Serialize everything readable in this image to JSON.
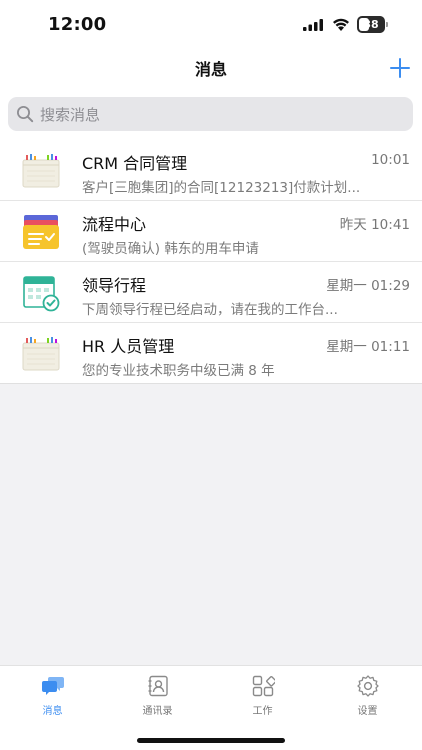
{
  "status_bar": {
    "time": "12:00",
    "battery_level": "38"
  },
  "nav": {
    "title": "消息",
    "add_icon": "plus-icon"
  },
  "search": {
    "placeholder": "搜索消息",
    "icon": "search-icon"
  },
  "messages": [
    {
      "title": "CRM 合同管理",
      "time": "10:01",
      "preview": "客户[三胞集团]的合同[12123213]付款计划...",
      "icon": "crm-folder-icon"
    },
    {
      "title": "流程中心",
      "time": "昨天 10:41",
      "preview": "(驾驶员确认) 韩东的用车申请",
      "icon": "workflow-folder-icon"
    },
    {
      "title": "领导行程",
      "time": "星期一 01:29",
      "preview": "下周领导行程已经启动，请在我的工作台...",
      "icon": "calendar-check-icon"
    },
    {
      "title": "HR 人员管理",
      "time": "星期一 01:11",
      "preview": "您的专业技术职务中级已满 8 年",
      "icon": "hr-folder-icon"
    }
  ],
  "tabs": [
    {
      "label": "消息",
      "icon": "chat-bubbles-icon",
      "active": true
    },
    {
      "label": "通讯录",
      "icon": "contacts-icon",
      "active": false
    },
    {
      "label": "工作",
      "icon": "apps-grid-icon",
      "active": false
    },
    {
      "label": "设置",
      "icon": "gear-icon",
      "active": false
    }
  ],
  "colors": {
    "accent": "#3c8df0",
    "background": "#f2f2f4"
  }
}
